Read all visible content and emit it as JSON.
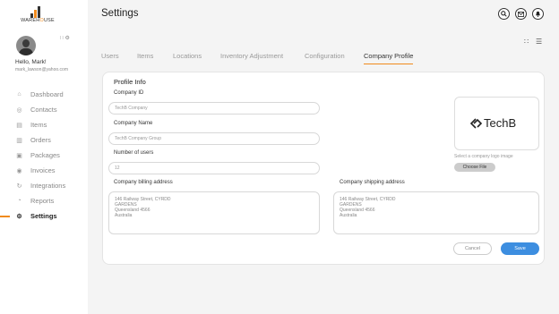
{
  "app": {
    "logo_prefix": "WAREH",
    "logo_o": "O",
    "logo_suffix": "USE"
  },
  "user": {
    "greeting": "Hello, Mark!",
    "email": "mark_lawson@yahoo.com"
  },
  "sidebar": {
    "items": [
      {
        "label": "Dashboard",
        "icon": "home-icon"
      },
      {
        "label": "Contacts",
        "icon": "contacts-icon"
      },
      {
        "label": "Items",
        "icon": "items-icon"
      },
      {
        "label": "Orders",
        "icon": "cart-icon"
      },
      {
        "label": "Packages",
        "icon": "package-icon"
      },
      {
        "label": "Invoices",
        "icon": "invoice-icon"
      },
      {
        "label": "Integrations",
        "icon": "integrations-icon"
      },
      {
        "label": "Reports",
        "icon": "reports-icon"
      },
      {
        "label": "Settings",
        "icon": "gear-icon",
        "active": true
      }
    ]
  },
  "header": {
    "title": "Settings"
  },
  "tabs": [
    {
      "label": "Users"
    },
    {
      "label": "Items"
    },
    {
      "label": "Locations"
    },
    {
      "label": "Inventory Adjustment"
    },
    {
      "label": "Configuration"
    },
    {
      "label": "Company Profile",
      "active": true
    }
  ],
  "form": {
    "section_title": "Profile Info",
    "company_id_label": "Company ID",
    "company_id_value": "TechB Company",
    "company_name_label": "Company Name",
    "company_name_value": "TechB Company Group",
    "users_label": "Number of users",
    "users_value": "12",
    "billing_label": "Company billing address",
    "billing_value": "146 Railway Street, CYRDD\nGARDENS\nQueensland 4566\nAustralia",
    "shipping_label": "Company shipping address",
    "shipping_value": "146 Railway Street, CYRDD\nGARDENS\nQueensland 4566\nAustralia",
    "logo_text": "TechB",
    "logo_hint": "Select a company logo image",
    "choose_file": "Choose File",
    "cancel": "Cancel",
    "save": "Save"
  },
  "colors": {
    "accent": "#f08a1c",
    "primary_button": "#3d8ee0"
  }
}
